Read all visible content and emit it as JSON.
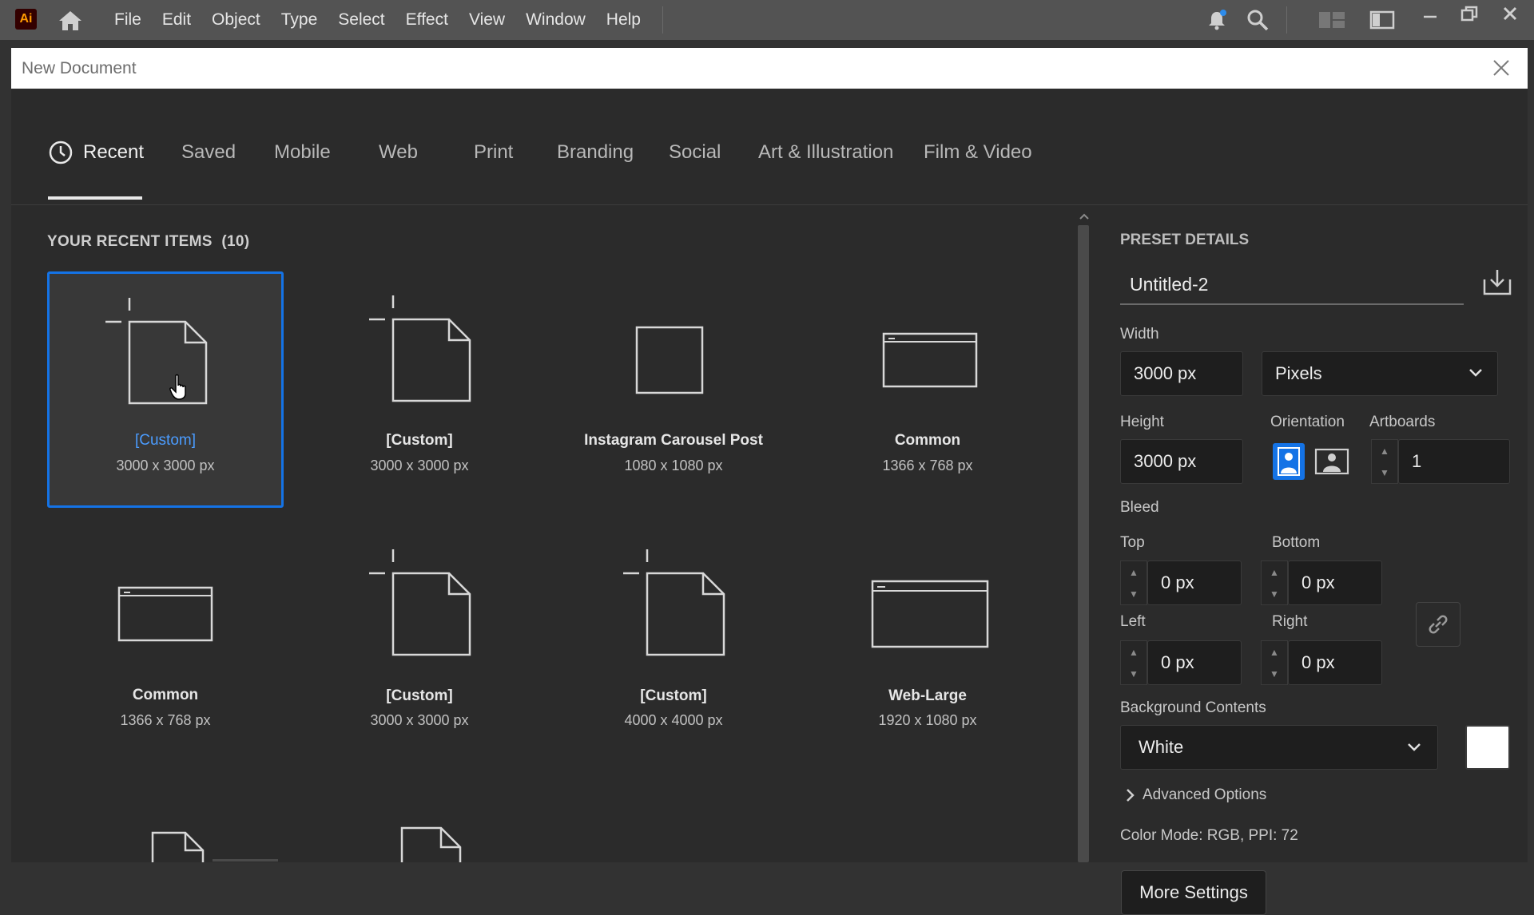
{
  "app": {
    "logo": "Ai"
  },
  "menu": [
    "File",
    "Edit",
    "Object",
    "Type",
    "Select",
    "Effect",
    "View",
    "Window",
    "Help"
  ],
  "dialog": {
    "title": "New Document"
  },
  "tabs": [
    "Recent",
    "Saved",
    "Mobile",
    "Web",
    "Print",
    "Branding",
    "Social",
    "Art & Illustration",
    "Film & Video"
  ],
  "recent": {
    "title": "YOUR RECENT ITEMS",
    "count": "(10)",
    "items": [
      {
        "name": "[Custom]",
        "dims": "3000 x 3000 px",
        "icon": "custom-doc-icon"
      },
      {
        "name": "[Custom]",
        "dims": "3000 x 3000 px",
        "icon": "custom-doc-icon"
      },
      {
        "name": "Instagram Carousel Post",
        "dims": "1080 x 1080 px",
        "icon": "square-icon"
      },
      {
        "name": "Common",
        "dims": "1366 x 768 px",
        "icon": "browser-window-icon"
      },
      {
        "name": "Common",
        "dims": "1366 x 768 px",
        "icon": "browser-window-icon"
      },
      {
        "name": "[Custom]",
        "dims": "3000 x 3000 px",
        "icon": "custom-doc-icon"
      },
      {
        "name": "[Custom]",
        "dims": "4000 x 4000 px",
        "icon": "custom-doc-icon"
      },
      {
        "name": "Web-Large",
        "dims": "1920 x 1080 px",
        "icon": "browser-window-icon"
      }
    ]
  },
  "preset": {
    "title": "PRESET DETAILS",
    "name": "Untitled-2",
    "width_label": "Width",
    "width": "3000 px",
    "units": "Pixels",
    "height_label": "Height",
    "height": "3000 px",
    "orientation_label": "Orientation",
    "artboards_label": "Artboards",
    "artboards": "1",
    "bleed_label": "Bleed",
    "top_label": "Top",
    "top": "0 px",
    "bottom_label": "Bottom",
    "bottom": "0 px",
    "left_label": "Left",
    "left": "0 px",
    "right_label": "Right",
    "right": "0 px",
    "bg_label": "Background Contents",
    "bg": "White",
    "advanced": "Advanced Options",
    "color_info": "Color Mode: RGB, PPI: 72",
    "more": "More Settings"
  },
  "colors": {
    "accent": "#1473e6",
    "selected_text": "#4b9cff"
  }
}
